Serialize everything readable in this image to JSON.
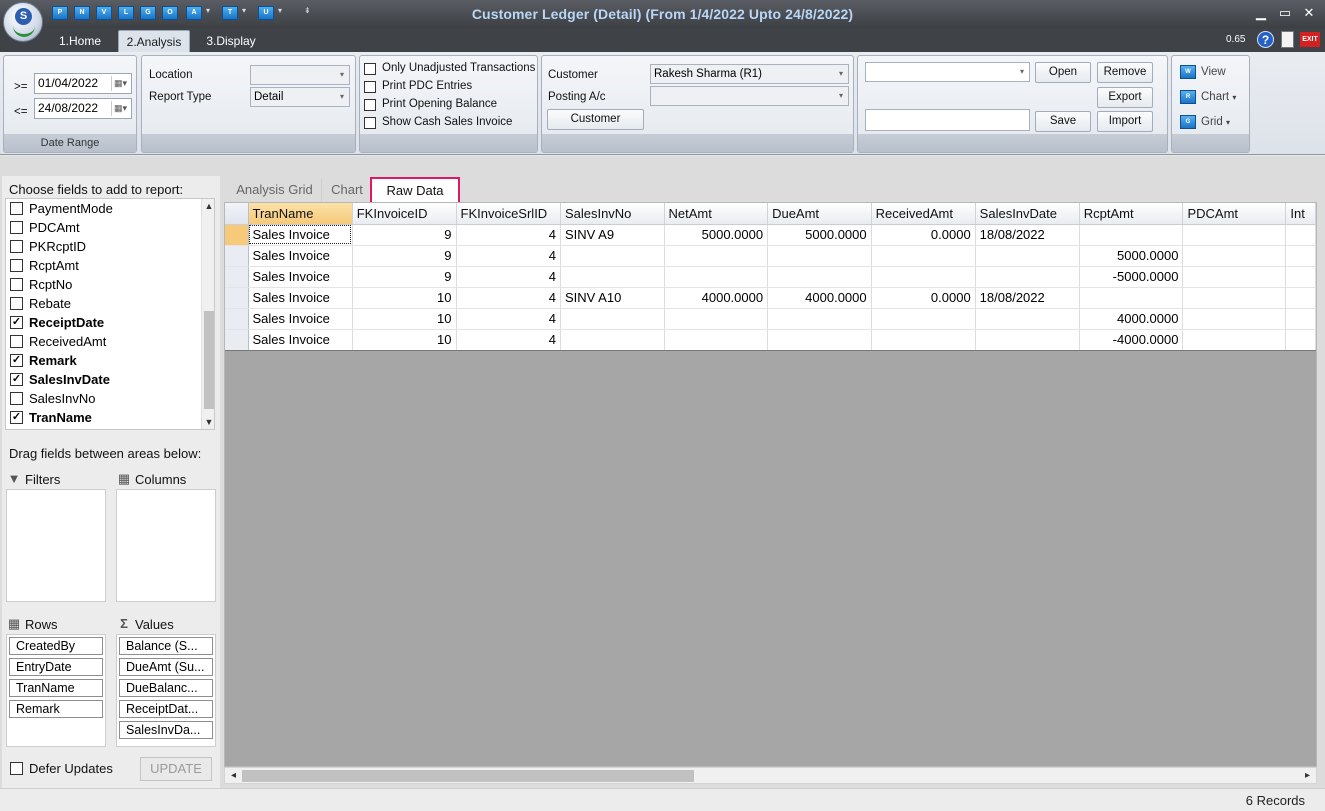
{
  "window": {
    "title": "Customer Ledger (Detail)  (From 1/4/2022 Upto 24/8/2022)",
    "zoom": "0.65",
    "quick_access": [
      "P",
      "N",
      "V",
      "L",
      "G",
      "O",
      "A",
      "T",
      "U"
    ]
  },
  "ribbon_tabs": [
    "1.Home",
    "2.Analysis",
    "3.Display"
  ],
  "date_range": {
    "from_op": ">=",
    "from": "01/04/2022",
    "to_op": "<=",
    "to": "24/08/2022",
    "group_label": "Date Range"
  },
  "filters": {
    "location_label": "Location",
    "location_value": "",
    "report_type_label": "Report Type",
    "report_type_value": "Detail"
  },
  "options": [
    {
      "label": "Only Unadjusted Transactions",
      "checked": false
    },
    {
      "label": "Print PDC Entries",
      "checked": false
    },
    {
      "label": "Print Opening Balance",
      "checked": false
    },
    {
      "label": "Show Cash Sales Invoice",
      "checked": false
    }
  ],
  "customer": {
    "customer_label": "Customer",
    "customer_value": "Rakesh Sharma  (R1)",
    "posting_label": "Posting A/c",
    "posting_value": "",
    "button": "Customer"
  },
  "layout_actions": {
    "open": "Open",
    "remove": "Remove",
    "export": "Export",
    "save": "Save",
    "import": "Import"
  },
  "view_menu": {
    "view": "View",
    "chart": "Chart",
    "grid": "Grid"
  },
  "field_chooser": {
    "title": "Choose fields to add to report:",
    "fields": [
      {
        "name": "PaymentMode",
        "checked": false
      },
      {
        "name": "PDCAmt",
        "checked": false
      },
      {
        "name": "PKRcptID",
        "checked": false
      },
      {
        "name": "RcptAmt",
        "checked": false
      },
      {
        "name": "RcptNo",
        "checked": false
      },
      {
        "name": "Rebate",
        "checked": false
      },
      {
        "name": "ReceiptDate",
        "checked": true
      },
      {
        "name": "ReceivedAmt",
        "checked": false
      },
      {
        "name": "Remark",
        "checked": true
      },
      {
        "name": "SalesInvDate",
        "checked": true
      },
      {
        "name": "SalesInvNo",
        "checked": false
      },
      {
        "name": "TranName",
        "checked": true
      }
    ],
    "drag_hint": "Drag fields between areas below:",
    "filters_label": "Filters",
    "columns_label": "Columns",
    "rows_label": "Rows",
    "values_label": "Values",
    "rows": [
      "CreatedBy",
      "EntryDate",
      "TranName",
      "Remark"
    ],
    "values": [
      "Balance (S...",
      "DueAmt (Su...",
      "DueBalanc...",
      "ReceiptDat...",
      "SalesInvDa..."
    ],
    "defer_label": "Defer Updates",
    "update_label": "UPDATE"
  },
  "view_tabs": [
    "Analysis Grid",
    "Chart",
    "Raw Data"
  ],
  "grid": {
    "columns": [
      "TranName",
      "FKInvoiceID",
      "FKInvoiceSrlID",
      "SalesInvNo",
      "NetAmt",
      "DueAmt",
      "ReceivedAmt",
      "SalesInvDate",
      "RcptAmt",
      "PDCAmt",
      "Int"
    ],
    "rows": [
      [
        "Sales Invoice",
        "9",
        "4",
        "SINV A9",
        "5000.0000",
        "5000.0000",
        "0.0000",
        "18/08/2022",
        "",
        "",
        ""
      ],
      [
        "Sales Invoice",
        "9",
        "4",
        "",
        "",
        "",
        "",
        "",
        "5000.0000",
        "",
        ""
      ],
      [
        "Sales Invoice",
        "9",
        "4",
        "",
        "",
        "",
        "",
        "",
        "-5000.0000",
        "",
        ""
      ],
      [
        "Sales Invoice",
        "10",
        "4",
        "SINV A10",
        "4000.0000",
        "4000.0000",
        "0.0000",
        "18/08/2022",
        "",
        "",
        ""
      ],
      [
        "Sales Invoice",
        "10",
        "4",
        "",
        "",
        "",
        "",
        "",
        "4000.0000",
        "",
        ""
      ],
      [
        "Sales Invoice",
        "10",
        "4",
        "",
        "",
        "",
        "",
        "",
        "-4000.0000",
        "",
        ""
      ]
    ]
  },
  "status": {
    "records": "6 Records"
  }
}
